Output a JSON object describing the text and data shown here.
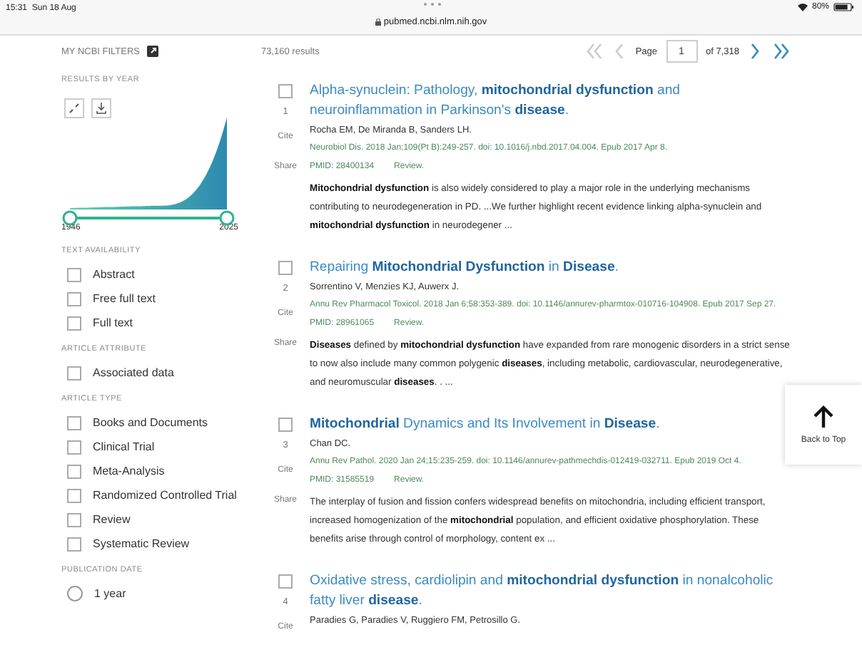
{
  "status_bar": {
    "time": "15:31",
    "date": "Sun 18 Aug",
    "url": "pubmed.ncbi.nlm.nih.gov",
    "battery": "80%"
  },
  "sidebar": {
    "header": "MY NCBI FILTERS",
    "results_by_year": {
      "title": "RESULTS BY YEAR",
      "start_year": "1946",
      "end_year": "2025",
      "thumbs": [
        {
          "level": 0
        },
        {
          "level": 1
        }
      ]
    },
    "sections": [
      {
        "title": "TEXT AVAILABILITY",
        "kind": "checkbox",
        "options": [
          {
            "label": "Abstract",
            "checked": false
          },
          {
            "label": "Free full text",
            "checked": false
          },
          {
            "label": "Full text",
            "checked": false
          }
        ]
      },
      {
        "title": "ARTICLE ATTRIBUTE",
        "kind": "checkbox",
        "options": [
          {
            "label": "Associated data",
            "checked": false
          }
        ]
      },
      {
        "title": "ARTICLE TYPE",
        "kind": "checkbox",
        "options": [
          {
            "label": "Books and Documents",
            "checked": false
          },
          {
            "label": "Clinical Trial",
            "checked": false
          },
          {
            "label": "Meta-Analysis",
            "checked": false
          },
          {
            "label": "Randomized Controlled Trial",
            "checked": false
          },
          {
            "label": "Review",
            "checked": false
          },
          {
            "label": "Systematic Review",
            "checked": false
          }
        ]
      },
      {
        "title": "PUBLICATION DATE",
        "kind": "radio",
        "options": [
          {
            "label": "1 year",
            "checked": false
          }
        ]
      }
    ]
  },
  "results_count": "73,160 results",
  "pagination": {
    "label": "Page",
    "page": "1",
    "total": "of 7,318"
  },
  "results": [
    {
      "number": "1",
      "checked": false,
      "cite": "Cite",
      "share": "Share",
      "title": "Alpha-synuclein: Pathology, **mitochondrial dysfunction** and neuroinflammation in Parkinson's **disease**.",
      "authors": "Rocha EM, De Miranda B, Sanders LH.",
      "citation": "Neurobiol Dis. 2018 Jan;109(Pt B):249-257. doi: 10.1016/j.nbd.2017.04.004. Epub 2017 Apr 8.",
      "pmid": "PMID: 28400134",
      "type": "Review.",
      "snippet": "**Mitochondrial dysfunction** is also widely considered to play a major role in the underlying mechanisms contributing to neurodegeneration in PD. ...We further highlight recent evidence linking alpha-synuclein and **mitochondrial dysfunction** in neurodegener ..."
    },
    {
      "number": "2",
      "checked": false,
      "cite": "Cite",
      "share": "Share",
      "title": "Repairing **Mitochondrial Dysfunction** in **Disease**.",
      "authors": "Sorrentino V, Menzies KJ, Auwerx J.",
      "citation": "Annu Rev Pharmacol Toxicol. 2018 Jan 6;58:353-389. doi: 10.1146/annurev-pharmtox-010716-104908. Epub 2017 Sep 27.",
      "pmid": "PMID: 28961065",
      "type": "Review.",
      "snippet": "**Diseases** defined by **mitochondrial dysfunction** have expanded from rare monogenic disorders in a strict sense to now also include many common polygenic **diseases**, including metabolic, cardiovascular, neurodegenerative, and neuromuscular **diseases**. . ..."
    },
    {
      "number": "3",
      "checked": false,
      "cite": "Cite",
      "share": "Share",
      "title": "**Mitochondrial** Dynamics and Its Involvement in **Disease**.",
      "authors": "Chan DC.",
      "citation": "Annu Rev Pathol. 2020 Jan 24;15:235-259. doi: 10.1146/annurev-pathmechdis-012419-032711. Epub 2019 Oct 4.",
      "pmid": "PMID: 31585519",
      "type": "Review.",
      "snippet": "The interplay of fusion and fission confers widespread benefits on mitochondria, including efficient transport, increased homogenization of the **mitochondrial** population, and efficient oxidative phosphorylation. These benefits arise through control of morphology, content ex ..."
    },
    {
      "number": "4",
      "checked": false,
      "cite": "Cite",
      "title": "Oxidative stress, cardiolipin and **mitochondrial dysfunction** in nonalcoholic fatty liver **disease**.",
      "authors": "Paradies G, Paradies V, Ruggiero FM, Petrosillo G."
    }
  ],
  "back_to_top": "Back to Top"
}
